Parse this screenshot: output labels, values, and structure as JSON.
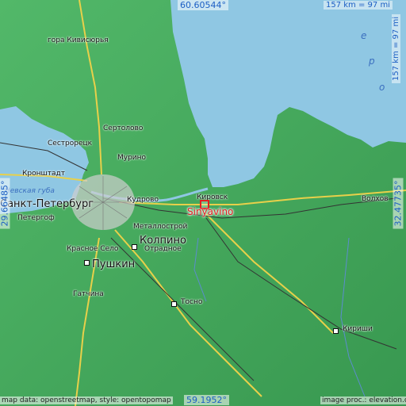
{
  "marker": {
    "name": "Sinyavino"
  },
  "coordinates": {
    "north": "60.60544°",
    "south": "59.1952°",
    "west": "29.66485°",
    "east": "32.47735°"
  },
  "scale": {
    "top": "157 km = 97 mi",
    "right": "157 km = 97 mi"
  },
  "attribution": {
    "left": "map data: openstreetmap, style: opentopomap",
    "right": "image proc.: elevation.city"
  },
  "water_labels": {
    "bay": "Невская губа",
    "lake_letters": [
      "е",
      "р",
      "о"
    ]
  },
  "places": {
    "kivisyurya": "гора Кивисюрья",
    "sertolovo": "Сертолово",
    "sestroretsk": "Сестрорецк",
    "murino": "Мурино",
    "kronshtadt": "Кронштадт",
    "kudrovo": "Кудрово",
    "kirovsk": "Кировск",
    "spb": "Санкт-Петербург",
    "petergof": "Петергоф",
    "metallostroy": "Металлострой",
    "kolpino": "Колпино",
    "krasnoe_selo": "Красное Село",
    "otradnoe": "Отрадное",
    "pushkin": "Пушкин",
    "gatchina": "Гатчина",
    "tosno": "Тосно",
    "kirishi": "Кириши",
    "volkhov": "Волхов",
    "east_city": "Волхов"
  },
  "colors": {
    "water": "#8fc7e3",
    "land": "#3fa85a",
    "pin": "#e02020",
    "coord_text": "#1c5fc4"
  }
}
